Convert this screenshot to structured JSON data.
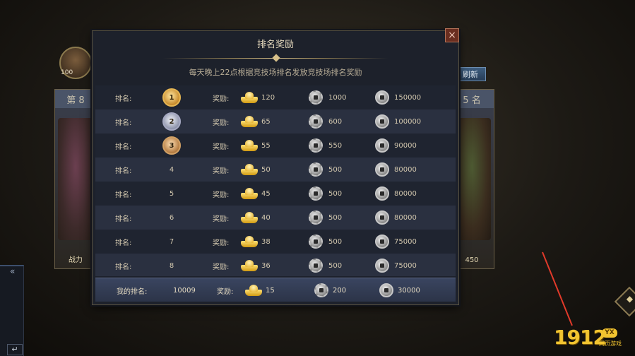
{
  "background": {
    "player_level": "100",
    "left_card_title": "第 8",
    "right_card_title": "5 名",
    "left_card_foot": "战力",
    "right_card_foot": "450",
    "refresh_label": "刷新",
    "side_enter_label": "↵"
  },
  "modal": {
    "title": "排名奖励",
    "subtitle": "每天晚上22点根据竞技场排名发放竞技场排名奖励",
    "close_label": "×",
    "rank_label": "排名:",
    "reward_label": "奖励:",
    "rows": [
      {
        "rank": "1",
        "medal": "gold",
        "ingot": "120",
        "coin1": "1000",
        "coin2": "150000"
      },
      {
        "rank": "2",
        "medal": "silver",
        "ingot": "65",
        "coin1": "600",
        "coin2": "100000"
      },
      {
        "rank": "3",
        "medal": "bronze",
        "ingot": "55",
        "coin1": "550",
        "coin2": "90000"
      },
      {
        "rank": "4",
        "medal": "",
        "ingot": "50",
        "coin1": "500",
        "coin2": "80000"
      },
      {
        "rank": "5",
        "medal": "",
        "ingot": "45",
        "coin1": "500",
        "coin2": "80000"
      },
      {
        "rank": "6",
        "medal": "",
        "ingot": "40",
        "coin1": "500",
        "coin2": "80000"
      },
      {
        "rank": "7",
        "medal": "",
        "ingot": "38",
        "coin1": "500",
        "coin2": "75000"
      },
      {
        "rank": "8",
        "medal": "",
        "ingot": "36",
        "coin1": "500",
        "coin2": "75000"
      }
    ],
    "my_rank": {
      "label": "我的排名:",
      "rank": "10009",
      "reward_label": "奖励:",
      "ingot": "15",
      "coin1": "200",
      "coin2": "30000"
    }
  },
  "watermark": {
    "text": "1912",
    "badge": "YX",
    "sub": "网页游戏"
  }
}
